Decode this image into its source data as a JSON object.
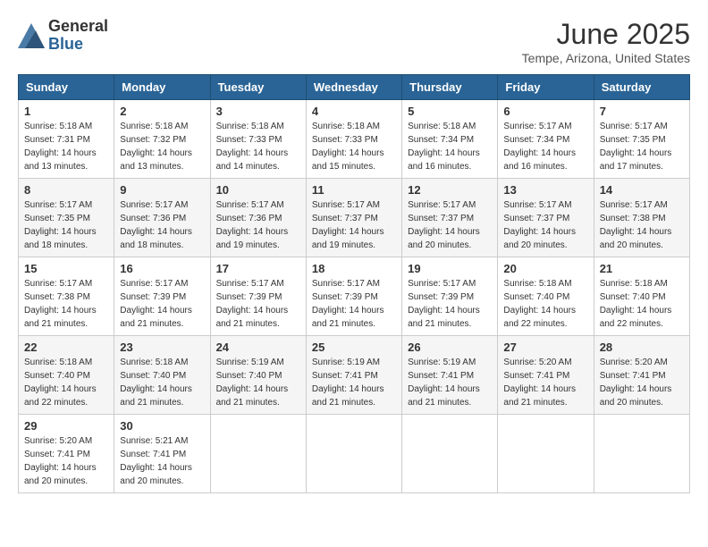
{
  "header": {
    "logo_line1": "General",
    "logo_line2": "Blue",
    "month_title": "June 2025",
    "location": "Tempe, Arizona, United States"
  },
  "days_of_week": [
    "Sunday",
    "Monday",
    "Tuesday",
    "Wednesday",
    "Thursday",
    "Friday",
    "Saturday"
  ],
  "weeks": [
    [
      {
        "day": "1",
        "info": "Sunrise: 5:18 AM\nSunset: 7:31 PM\nDaylight: 14 hours\nand 13 minutes."
      },
      {
        "day": "2",
        "info": "Sunrise: 5:18 AM\nSunset: 7:32 PM\nDaylight: 14 hours\nand 13 minutes."
      },
      {
        "day": "3",
        "info": "Sunrise: 5:18 AM\nSunset: 7:33 PM\nDaylight: 14 hours\nand 14 minutes."
      },
      {
        "day": "4",
        "info": "Sunrise: 5:18 AM\nSunset: 7:33 PM\nDaylight: 14 hours\nand 15 minutes."
      },
      {
        "day": "5",
        "info": "Sunrise: 5:18 AM\nSunset: 7:34 PM\nDaylight: 14 hours\nand 16 minutes."
      },
      {
        "day": "6",
        "info": "Sunrise: 5:17 AM\nSunset: 7:34 PM\nDaylight: 14 hours\nand 16 minutes."
      },
      {
        "day": "7",
        "info": "Sunrise: 5:17 AM\nSunset: 7:35 PM\nDaylight: 14 hours\nand 17 minutes."
      }
    ],
    [
      {
        "day": "8",
        "info": "Sunrise: 5:17 AM\nSunset: 7:35 PM\nDaylight: 14 hours\nand 18 minutes."
      },
      {
        "day": "9",
        "info": "Sunrise: 5:17 AM\nSunset: 7:36 PM\nDaylight: 14 hours\nand 18 minutes."
      },
      {
        "day": "10",
        "info": "Sunrise: 5:17 AM\nSunset: 7:36 PM\nDaylight: 14 hours\nand 19 minutes."
      },
      {
        "day": "11",
        "info": "Sunrise: 5:17 AM\nSunset: 7:37 PM\nDaylight: 14 hours\nand 19 minutes."
      },
      {
        "day": "12",
        "info": "Sunrise: 5:17 AM\nSunset: 7:37 PM\nDaylight: 14 hours\nand 20 minutes."
      },
      {
        "day": "13",
        "info": "Sunrise: 5:17 AM\nSunset: 7:37 PM\nDaylight: 14 hours\nand 20 minutes."
      },
      {
        "day": "14",
        "info": "Sunrise: 5:17 AM\nSunset: 7:38 PM\nDaylight: 14 hours\nand 20 minutes."
      }
    ],
    [
      {
        "day": "15",
        "info": "Sunrise: 5:17 AM\nSunset: 7:38 PM\nDaylight: 14 hours\nand 21 minutes."
      },
      {
        "day": "16",
        "info": "Sunrise: 5:17 AM\nSunset: 7:39 PM\nDaylight: 14 hours\nand 21 minutes."
      },
      {
        "day": "17",
        "info": "Sunrise: 5:17 AM\nSunset: 7:39 PM\nDaylight: 14 hours\nand 21 minutes."
      },
      {
        "day": "18",
        "info": "Sunrise: 5:17 AM\nSunset: 7:39 PM\nDaylight: 14 hours\nand 21 minutes."
      },
      {
        "day": "19",
        "info": "Sunrise: 5:17 AM\nSunset: 7:39 PM\nDaylight: 14 hours\nand 21 minutes."
      },
      {
        "day": "20",
        "info": "Sunrise: 5:18 AM\nSunset: 7:40 PM\nDaylight: 14 hours\nand 22 minutes."
      },
      {
        "day": "21",
        "info": "Sunrise: 5:18 AM\nSunset: 7:40 PM\nDaylight: 14 hours\nand 22 minutes."
      }
    ],
    [
      {
        "day": "22",
        "info": "Sunrise: 5:18 AM\nSunset: 7:40 PM\nDaylight: 14 hours\nand 22 minutes."
      },
      {
        "day": "23",
        "info": "Sunrise: 5:18 AM\nSunset: 7:40 PM\nDaylight: 14 hours\nand 21 minutes."
      },
      {
        "day": "24",
        "info": "Sunrise: 5:19 AM\nSunset: 7:40 PM\nDaylight: 14 hours\nand 21 minutes."
      },
      {
        "day": "25",
        "info": "Sunrise: 5:19 AM\nSunset: 7:41 PM\nDaylight: 14 hours\nand 21 minutes."
      },
      {
        "day": "26",
        "info": "Sunrise: 5:19 AM\nSunset: 7:41 PM\nDaylight: 14 hours\nand 21 minutes."
      },
      {
        "day": "27",
        "info": "Sunrise: 5:20 AM\nSunset: 7:41 PM\nDaylight: 14 hours\nand 21 minutes."
      },
      {
        "day": "28",
        "info": "Sunrise: 5:20 AM\nSunset: 7:41 PM\nDaylight: 14 hours\nand 20 minutes."
      }
    ],
    [
      {
        "day": "29",
        "info": "Sunrise: 5:20 AM\nSunset: 7:41 PM\nDaylight: 14 hours\nand 20 minutes."
      },
      {
        "day": "30",
        "info": "Sunrise: 5:21 AM\nSunset: 7:41 PM\nDaylight: 14 hours\nand 20 minutes."
      },
      {
        "day": "",
        "info": ""
      },
      {
        "day": "",
        "info": ""
      },
      {
        "day": "",
        "info": ""
      },
      {
        "day": "",
        "info": ""
      },
      {
        "day": "",
        "info": ""
      }
    ]
  ]
}
